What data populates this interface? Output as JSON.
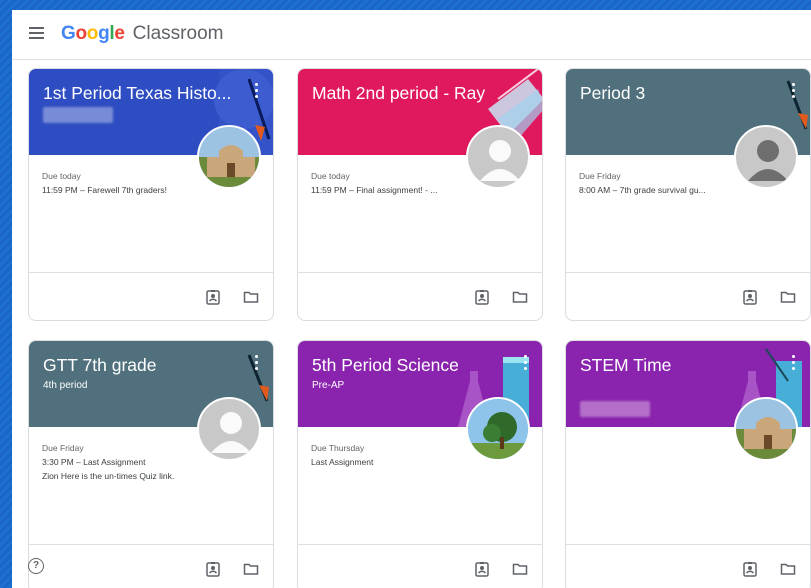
{
  "app": {
    "brand_google": "Google",
    "brand_product": "Classroom"
  },
  "colors": {
    "blue_banner": "#2f4dc2",
    "pink_banner": "#e0195f",
    "slate_banner": "#50707d",
    "purple_banner": "#8a23ad",
    "page_bg": "#1d6fd0"
  },
  "cards": [
    {
      "title": "1st Period Texas Histo...",
      "subtitle": "",
      "due_when": "Due today",
      "due_line": "11:59 PM – Farewell 7th graders!",
      "due_extra": "",
      "avatar": "alamo-photo"
    },
    {
      "title": "Math 2nd period - Ray",
      "subtitle": "",
      "due_when": "Due today",
      "due_line": "11:59 PM – Final assignment! - ...",
      "due_extra": "",
      "avatar": "default-person"
    },
    {
      "title": "Period 3",
      "subtitle": "",
      "due_when": "Due Friday",
      "due_line": "8:00 AM – 7th grade survival gu...",
      "due_extra": "",
      "avatar": "default-person"
    },
    {
      "title": "GTT 7th grade",
      "subtitle": "4th period",
      "due_when": "Due Friday",
      "due_line": "3:30 PM – Last Assignment",
      "due_extra": "Zion Here is the un-times Quiz link.",
      "avatar": "default-person"
    },
    {
      "title": "5th Period Science",
      "subtitle": "Pre-AP",
      "due_when": "Due Thursday",
      "due_line": "Last Assignment",
      "due_extra": "",
      "avatar": "tree-photo"
    },
    {
      "title": "STEM Time",
      "subtitle": "",
      "due_when": "",
      "due_line": "",
      "due_extra": "",
      "avatar": "alamo-photo"
    }
  ],
  "icons": {
    "menu": "hamburger-menu-icon",
    "gradebook": "assignment-ind-icon",
    "folder": "folder-icon",
    "help": "help-circle-icon"
  },
  "help": {
    "glyph": "?"
  }
}
